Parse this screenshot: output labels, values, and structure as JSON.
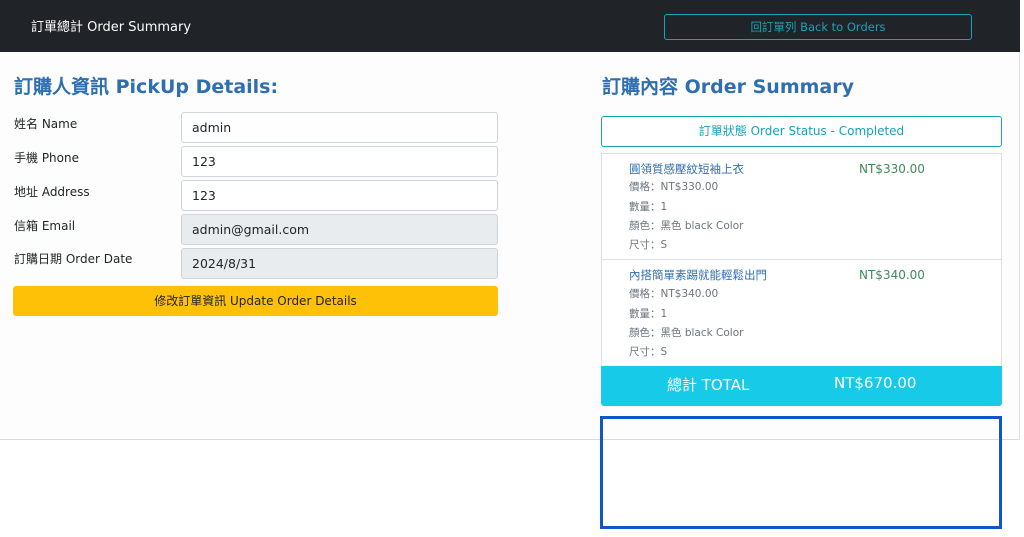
{
  "header": {
    "title": "訂單總計 Order Summary",
    "back_button": "回訂單列 Back to Orders"
  },
  "pickup": {
    "heading": "訂購人資訊 PickUp Details:",
    "fields": [
      {
        "label": "姓名 Name",
        "value": "admin",
        "readonly": false
      },
      {
        "label": "手機 Phone",
        "value": "123",
        "readonly": false
      },
      {
        "label": "地址 Address",
        "value": "123",
        "readonly": false
      },
      {
        "label": "信箱 Email",
        "value": "admin@gmail.com",
        "readonly": true
      },
      {
        "label": "訂購日期 Order Date",
        "value": "2024/8/31",
        "readonly": true
      }
    ],
    "update_button": "修改訂單資訊 Update Order Details"
  },
  "summary": {
    "heading": "訂購內容 Order Summary",
    "status_button": "訂單狀態 Order Status - Completed",
    "items": [
      {
        "name": "圓領質感壓紋短袖上衣",
        "price": "NT$330.00",
        "unit_price": "價格：NT$330.00",
        "quantity": "數量：1",
        "color": "顏色：黑色 black Color",
        "size": "尺寸：S"
      },
      {
        "name": "內搭簡單素踢就能輕鬆出門",
        "price": "NT$340.00",
        "unit_price": "價格：NT$340.00",
        "quantity": "數量：1",
        "color": "顏色：黑色 black Color",
        "size": "尺寸：S"
      }
    ],
    "total_label": "總計 TOTAL",
    "total_value": "NT$670.00"
  },
  "colors": {
    "topbar": "#202428",
    "accent_info": "#17a2b8",
    "heading_blue": "#2f6fb0",
    "warning": "#ffc107",
    "total_bar": "#17cae8",
    "highlight_border": "#1155cc"
  }
}
